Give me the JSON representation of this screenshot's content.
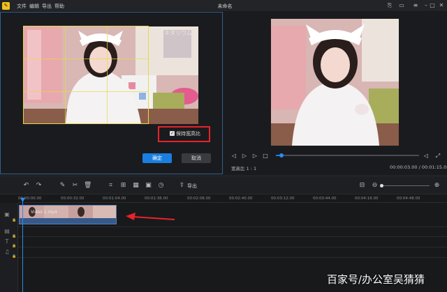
{
  "app": {
    "title": "未命名",
    "menu": [
      "文件",
      "编辑",
      "导出",
      "帮助"
    ],
    "window_controls": [
      "share-icon",
      "monitor-icon",
      "menu-icon",
      "minimize-icon",
      "maximize-icon",
      "close-icon"
    ]
  },
  "crop_editor": {
    "keep_ratio_label": "保持宽高比",
    "keep_ratio_checked": true,
    "confirm_label": "确定",
    "cancel_label": "取消",
    "preview_banner": "プラネタリウム"
  },
  "player": {
    "aspect_ratio_label": "宽高比 1 : 1",
    "time_readout": "00:00:03.00 / 00:01:15.05",
    "progress": 0.04
  },
  "toolbar": {
    "export_label": "导出",
    "zoom_level": 0.02
  },
  "timeline": {
    "ruler_ticks": [
      "00:00:00.00",
      "00:00:32.00",
      "00:01:04.00",
      "00:01:36.00",
      "00:02:08.00",
      "00:02:40.00",
      "00:03:12.00",
      "00:03:44.00",
      "00:04:16.00",
      "00:04:48.00"
    ],
    "clip_label": "Video 1.mp4"
  },
  "colors": {
    "accent": "#1a7fe0",
    "highlight_box": "#e8232a",
    "crop_guide": "#e8d84a",
    "clip": "#3c5f8f"
  },
  "watermark": "百家号/办公室吴猜猜"
}
